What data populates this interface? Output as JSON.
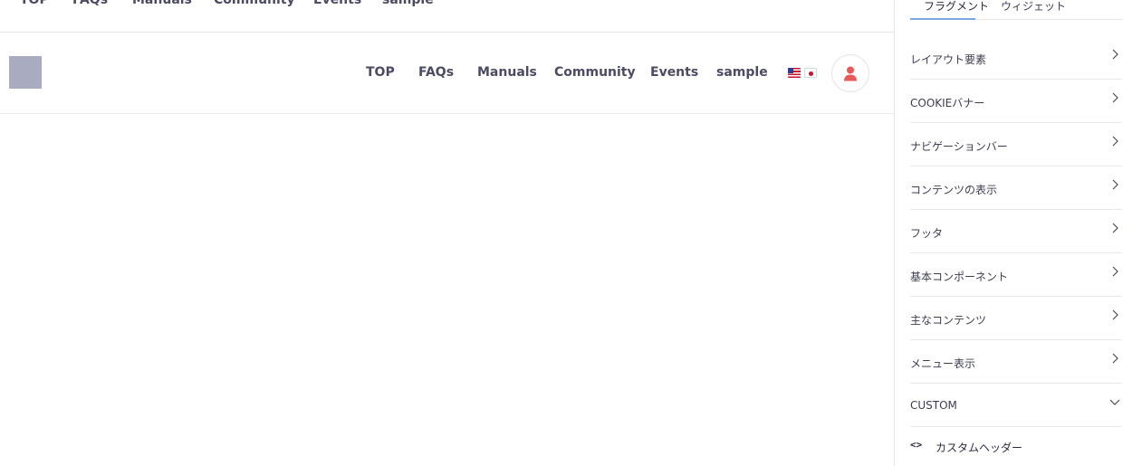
{
  "ghost_nav": {
    "items": [
      "TOP",
      "FAQs",
      "Manuals",
      "Community",
      "Events",
      "sample"
    ]
  },
  "nav": {
    "links": [
      "TOP",
      "FAQs",
      "Manuals",
      "Community",
      "Events",
      "sample"
    ],
    "languages": [
      "en-us-flag",
      "ja-jp-flag"
    ],
    "user_icon": "user-icon"
  },
  "sidebar": {
    "tabs": [
      "フラグメント",
      "ウィジェット"
    ],
    "active_tab": 0,
    "sections": [
      {
        "label": "レイアウト要素",
        "state": "collapsed"
      },
      {
        "label": "COOKIEバナー",
        "state": "collapsed"
      },
      {
        "label": "ナビゲーションバー",
        "state": "collapsed"
      },
      {
        "label": "コンテンツの表示",
        "state": "collapsed"
      },
      {
        "label": "フッタ",
        "state": "collapsed"
      },
      {
        "label": "基本コンポーネント",
        "state": "collapsed"
      },
      {
        "label": "主なコンテンツ",
        "state": "collapsed"
      },
      {
        "label": "メニュー表示",
        "state": "collapsed"
      },
      {
        "label": "CUSTOM",
        "state": "expanded"
      }
    ],
    "custom_items": [
      {
        "icon": "code-icon",
        "label": "カスタムヘッダー"
      }
    ]
  },
  "colors": {
    "accent": "#7da7e2",
    "avatar_icon": "#e85a5a",
    "logo_placeholder": "#a9abc0",
    "nav_text": "#4b4b63"
  }
}
